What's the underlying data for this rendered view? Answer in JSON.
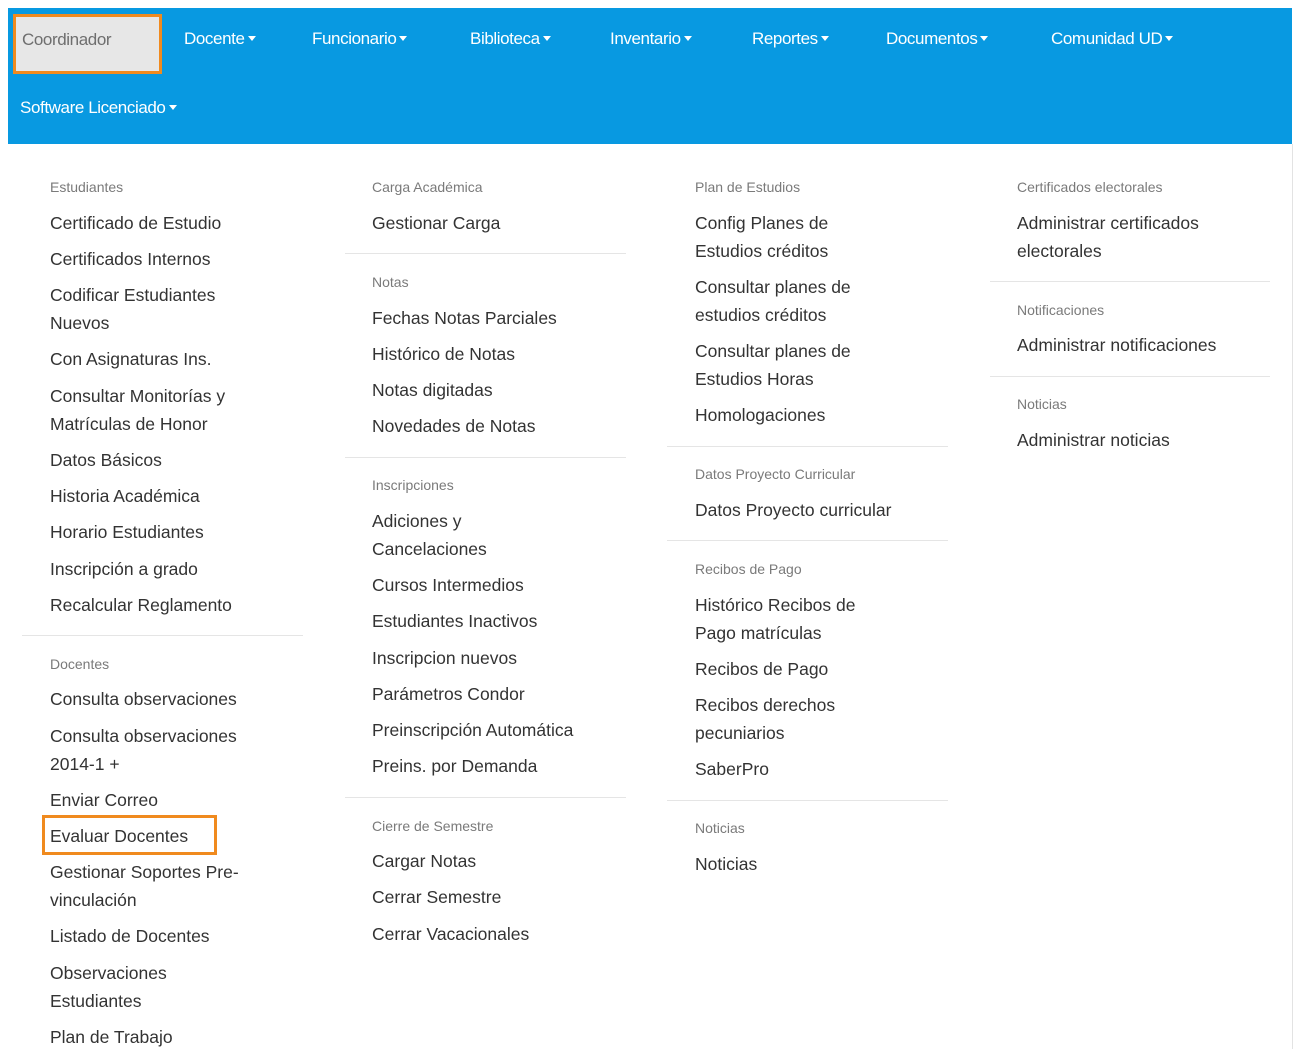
{
  "nav": {
    "coordinador": "Coordinador",
    "docente": "Docente",
    "funcionario": "Funcionario",
    "biblioteca": "Biblioteca",
    "inventario": "Inventario",
    "reportes": "Reportes",
    "documentos": "Documentos",
    "comunidad": "Comunidad UD",
    "software": "Software Licenciado"
  },
  "col1": {
    "estudiantes_header": "Estudiantes",
    "estudiantes": [
      "Certificado de Estudio",
      "Certificados Internos",
      "Codificar Estudiantes",
      "Nuevos",
      "Con Asignaturas Ins.",
      "Consultar Monitorías y",
      "Matrículas de Honor",
      "Datos Básicos",
      "Historia Académica",
      "Horario Estudiantes",
      "Inscripción a grado",
      "Recalcular Reglamento"
    ],
    "docentes_header": "Docentes",
    "docentes": [
      "Consulta observaciones",
      "Consulta observaciones",
      "2014-1 +",
      "Enviar Correo",
      "Evaluar Docentes",
      "Gestionar Soportes Pre-",
      "vinculación",
      "Listado de Docentes",
      "Observaciones",
      "Estudiantes",
      "Plan de Trabajo"
    ]
  },
  "col2": {
    "carga_header": "Carga Académica",
    "carga": [
      "Gestionar Carga"
    ],
    "notas_header": "Notas",
    "notas": [
      "Fechas Notas Parciales",
      "Histórico de Notas",
      "Notas digitadas",
      "Novedades de Notas"
    ],
    "inscripciones_header": "Inscripciones",
    "inscripciones": [
      "Adiciones y",
      "Cancelaciones",
      "Cursos Intermedios",
      "Estudiantes Inactivos",
      "Inscripcion nuevos",
      "Parámetros Condor",
      "Preinscripción Automática",
      "Preins. por Demanda"
    ],
    "cierre_header": "Cierre de Semestre",
    "cierre": [
      "Cargar Notas",
      "Cerrar Semestre",
      "Cerrar Vacacionales"
    ]
  },
  "col3": {
    "plan_header": "Plan de Estudios",
    "plan": [
      "Config Planes de",
      "Estudios créditos",
      "Consultar planes de",
      "estudios créditos",
      "Consultar planes de",
      "Estudios Horas",
      "Homologaciones"
    ],
    "datos_header": "Datos Proyecto Curricular",
    "datos": [
      "Datos Proyecto curricular"
    ],
    "recibos_header": "Recibos de Pago",
    "recibos": [
      "Histórico Recibos de",
      "Pago matrículas",
      "Recibos de Pago",
      "Recibos derechos",
      "pecuniarios",
      "SaberPro"
    ],
    "noticias_header": "Noticias",
    "noticias": [
      "Noticias"
    ]
  },
  "col4": {
    "cert_header": "Certificados electorales",
    "cert": [
      "Administrar certificados",
      "electorales"
    ],
    "notif_header": "Notificaciones",
    "notif": [
      "Administrar notificaciones"
    ],
    "noticias_header": "Noticias",
    "noticias": [
      "Administrar noticias"
    ]
  },
  "colors": {
    "navbar": "#0899e1",
    "highlight": "#f08a1e"
  }
}
